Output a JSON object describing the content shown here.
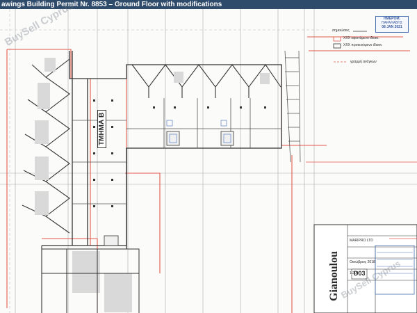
{
  "window": {
    "title": "awings Building Permit Nr. 8853 – Ground Floor with modifications"
  },
  "watermarks": [
    "BuySell Cyprus",
    "BuySell Cyprus"
  ],
  "plan": {
    "section_label": "ΤΜΗΜΑ Β",
    "legend": {
      "title": "σημειώσεις",
      "line1": "XXX υφιστάμενο ιδιοκτ.",
      "line2": "XXX προτεινόμενο ιδιοκτ.",
      "line3": "γραμμή ανάγκων"
    },
    "stamp": {
      "header": "ΗΜΕΡΟΜ.",
      "sub": "ΠΑΡΑΛΑΒΗΣ",
      "date": "08 JAN 2021"
    },
    "title_block": {
      "architect": "Gianoulou",
      "client": "MARIPRO LTD",
      "date_label": "Οκτώβριος 2018",
      "scale": "1:200",
      "sheet": "D03"
    }
  },
  "colors": {
    "title_bar": "#2f4b6b",
    "modification_red": "#e05a4a",
    "linework": "#3a3a3a",
    "grid": "#9a9a9a"
  }
}
